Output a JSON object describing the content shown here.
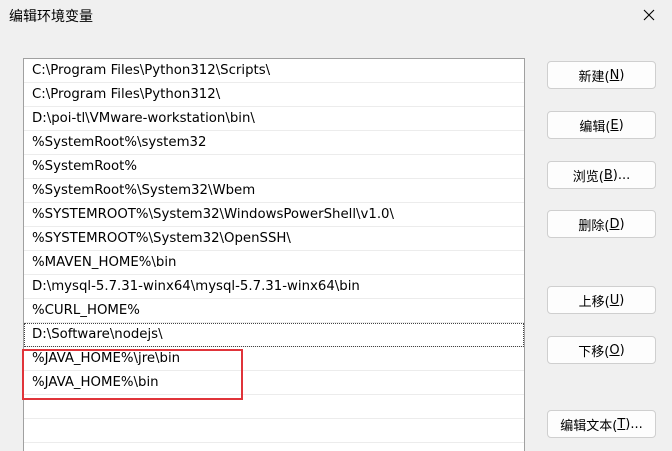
{
  "window": {
    "title": "编辑环境变量",
    "close_icon": "close-icon"
  },
  "path_list": {
    "items": [
      "C:\\Program Files\\Python312\\Scripts\\",
      "C:\\Program Files\\Python312\\",
      "D:\\poi-tl\\VMware-workstation\\bin\\",
      "%SystemRoot%\\system32",
      "%SystemRoot%",
      "%SystemRoot%\\System32\\Wbem",
      "%SYSTEMROOT%\\System32\\WindowsPowerShell\\v1.0\\",
      "%SYSTEMROOT%\\System32\\OpenSSH\\",
      "%MAVEN_HOME%\\bin",
      "D:\\mysql-5.7.31-winx64\\mysql-5.7.31-winx64\\bin",
      "%CURL_HOME%",
      "D:\\Software\\nodejs\\",
      "%JAVA_HOME%\\jre\\bin",
      "%JAVA_HOME%\\bin",
      "",
      ""
    ],
    "selected_index": 11,
    "highlight_color": "#e0343a"
  },
  "buttons": {
    "new": {
      "text": "新建(",
      "key": "N",
      "end": ")"
    },
    "edit": {
      "text": "编辑(",
      "key": "E",
      "end": ")"
    },
    "browse": {
      "text": "浏览(",
      "key": "B",
      "end": ")..."
    },
    "delete": {
      "text": "删除(",
      "key": "D",
      "end": ")"
    },
    "move_up": {
      "text": "上移(",
      "key": "U",
      "end": ")"
    },
    "move_down": {
      "text": "下移(",
      "key": "O",
      "end": ")"
    },
    "edit_text": {
      "text": "编辑文本(",
      "key": "T",
      "end": ")..."
    }
  }
}
